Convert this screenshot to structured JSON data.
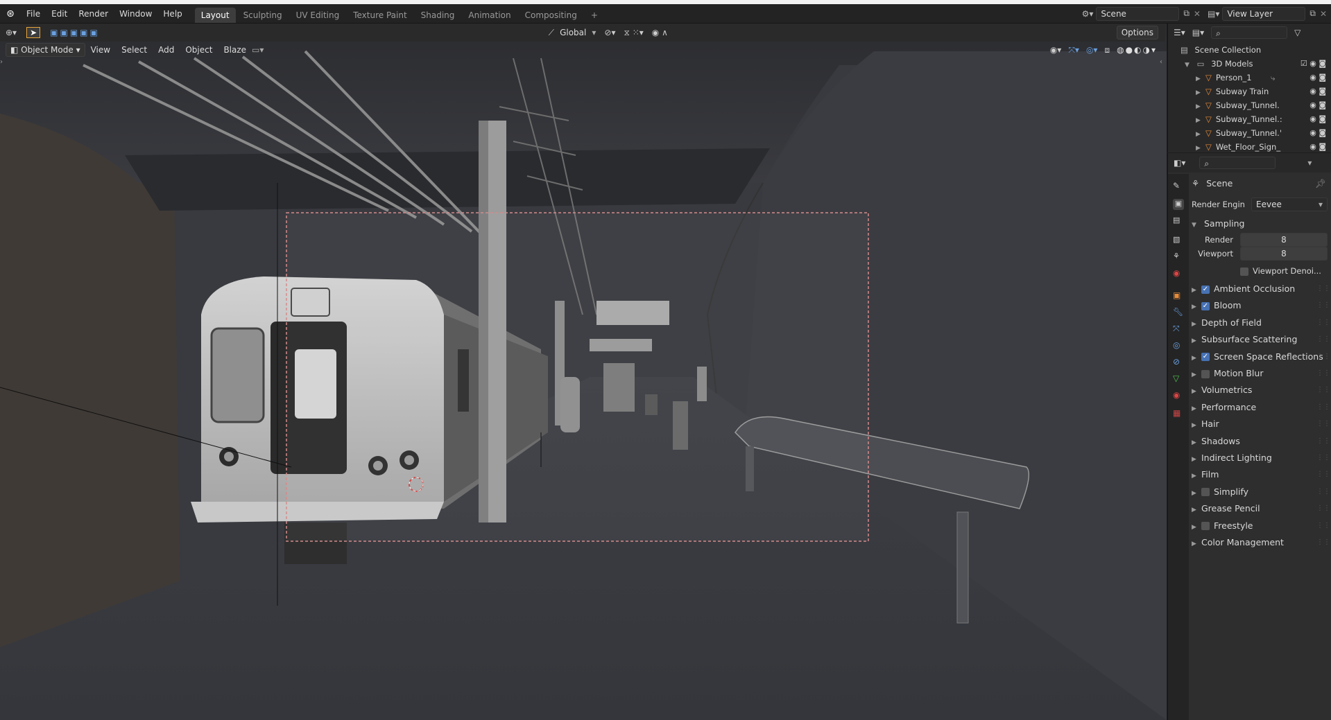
{
  "menu": {
    "items": [
      "File",
      "Edit",
      "Render",
      "Window",
      "Help"
    ]
  },
  "workspaces": {
    "tabs": [
      "Layout",
      "Sculpting",
      "UV Editing",
      "Texture Paint",
      "Shading",
      "Animation",
      "Compositing"
    ],
    "active": "Layout",
    "add_symbol": "+"
  },
  "scene_selector": {
    "label": "Scene"
  },
  "view_layer": {
    "label": "View Layer"
  },
  "viewport_toolbar": {
    "orientation": "Global",
    "options_label": "Options"
  },
  "viewport_header": {
    "mode": "Object Mode",
    "menus": [
      "View",
      "Select",
      "Add",
      "Object",
      "Blaze"
    ]
  },
  "outliner": {
    "root": "Scene Collection",
    "collection": "3D Models",
    "objects": [
      "Person_1",
      "Subway Train",
      "Subway_Tunnel.",
      "Subway_Tunnel.:",
      "Subway_Tunnel.'",
      "Wet_Floor_Sign_"
    ]
  },
  "properties": {
    "context": "Scene",
    "render_engine_label": "Render Engin",
    "render_engine_value": "Eevee",
    "sampling": {
      "title": "Sampling",
      "render_label": "Render",
      "render_value": "8",
      "viewport_label": "Viewport",
      "viewport_value": "8",
      "denoise_label": "Viewport Denoi..."
    },
    "panels": [
      {
        "label": "Ambient Occlusion",
        "checkbox": true,
        "checked": true
      },
      {
        "label": "Bloom",
        "checkbox": true,
        "checked": true
      },
      {
        "label": "Depth of Field",
        "checkbox": false,
        "checked": false
      },
      {
        "label": "Subsurface Scattering",
        "checkbox": false,
        "checked": false
      },
      {
        "label": "Screen Space Reflections",
        "checkbox": true,
        "checked": true
      },
      {
        "label": "Motion Blur",
        "checkbox": true,
        "checked": false
      },
      {
        "label": "Volumetrics",
        "checkbox": false,
        "checked": false
      },
      {
        "label": "Performance",
        "checkbox": false,
        "checked": false
      },
      {
        "label": "Hair",
        "checkbox": false,
        "checked": false
      },
      {
        "label": "Shadows",
        "checkbox": false,
        "checked": false
      },
      {
        "label": "Indirect Lighting",
        "checkbox": false,
        "checked": false
      },
      {
        "label": "Film",
        "checkbox": false,
        "checked": false
      },
      {
        "label": "Simplify",
        "checkbox": true,
        "checked": false
      },
      {
        "label": "Grease Pencil",
        "checkbox": false,
        "checked": false
      },
      {
        "label": "Freestyle",
        "checkbox": true,
        "checked": false
      },
      {
        "label": "Color Management",
        "checkbox": false,
        "checked": false
      }
    ]
  },
  "colors": {
    "accent": "#4772b3",
    "object_orange": "#e88c3a",
    "panel_bg": "#2e2e2e",
    "viewport_bg": "#3b3d42"
  }
}
